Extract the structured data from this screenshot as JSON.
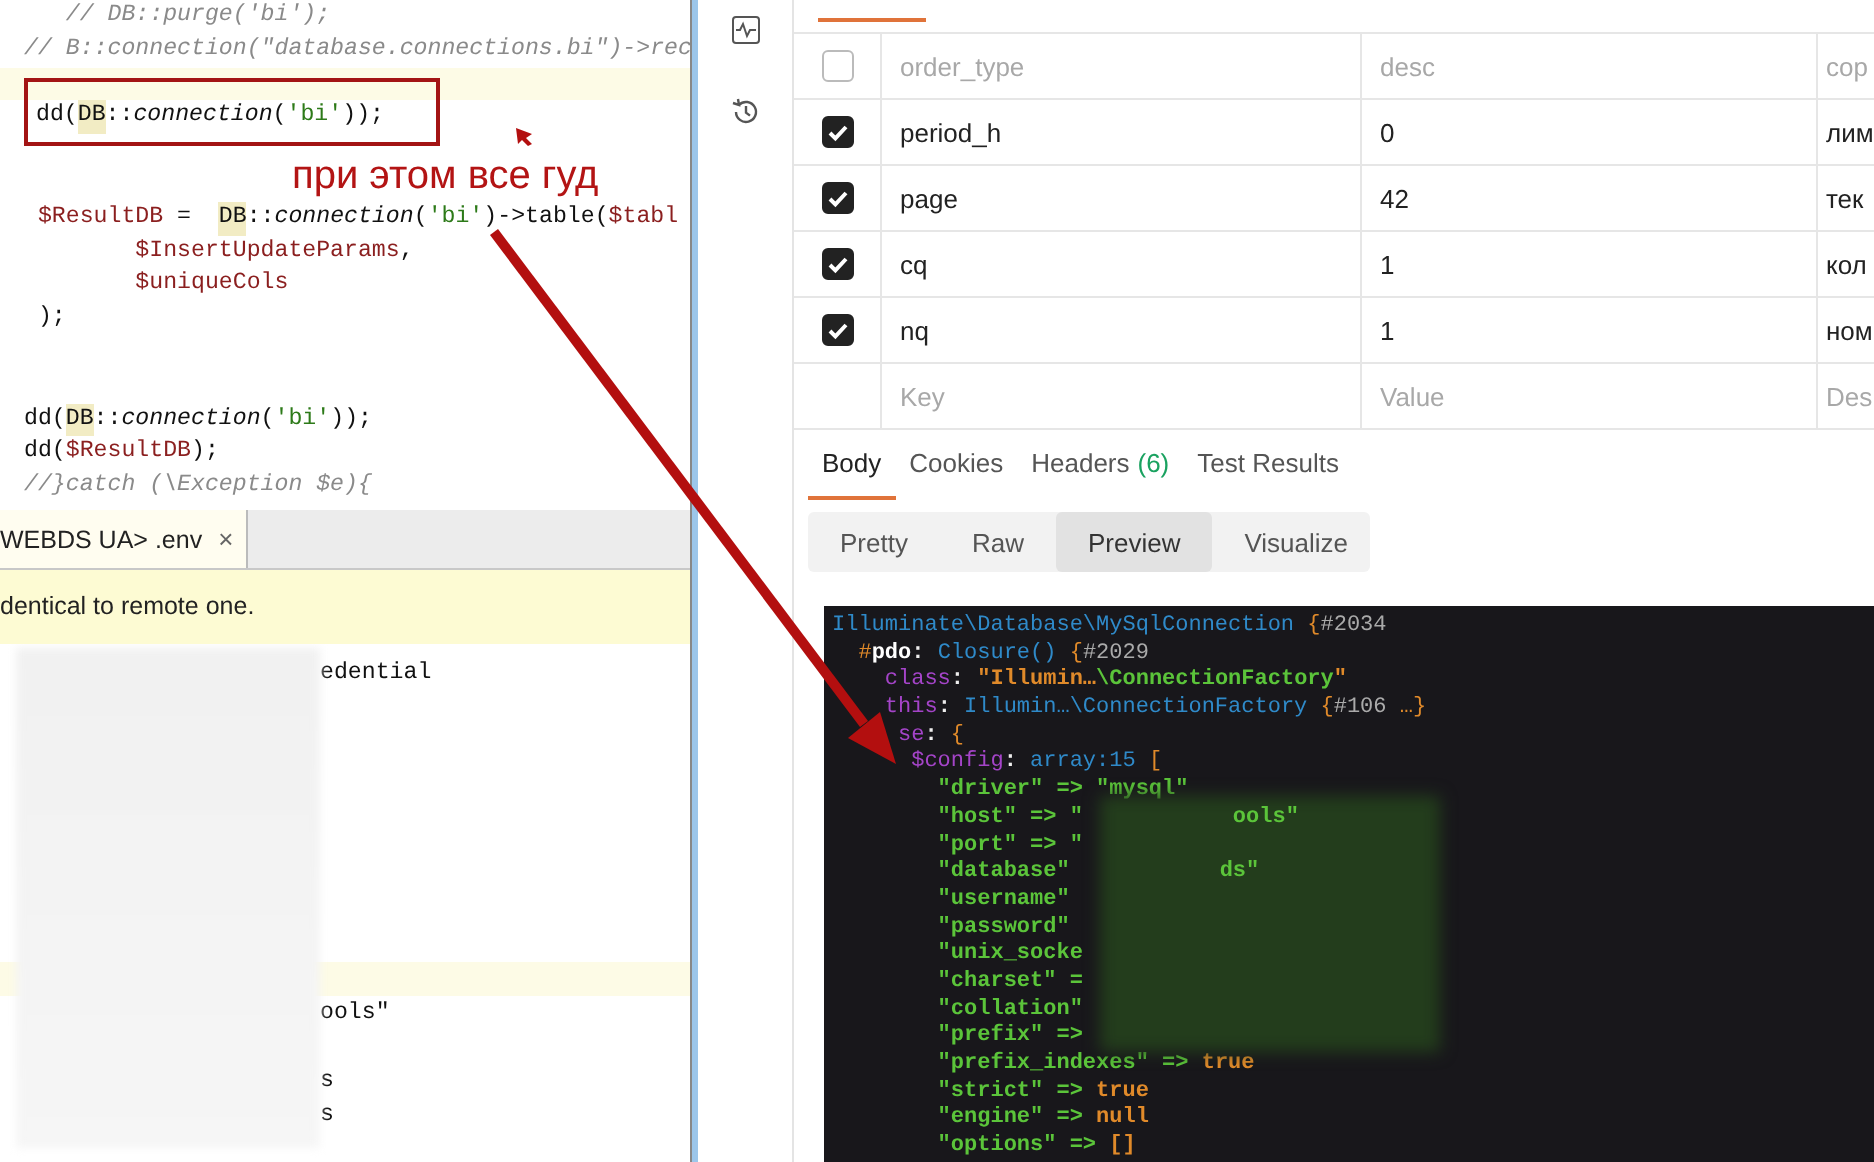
{
  "editor": {
    "lines": [
      {
        "kind": "code",
        "tokens": [
          {
            "kind": "comment",
            "text": "   // DB::purge('bi');"
          }
        ]
      },
      {
        "kind": "code",
        "tokens": [
          {
            "kind": "comment",
            "text": "// B::connection(\"database.connections.bi\")->rec"
          }
        ]
      },
      {
        "kind": "current"
      },
      {
        "kind": "code",
        "boxed": true,
        "tokens": [
          {
            "kind": "plain",
            "text": "dd("
          },
          {
            "kind": "cls",
            "text": "DB"
          },
          {
            "kind": "plain",
            "text": "::"
          },
          {
            "kind": "method",
            "text": "connection"
          },
          {
            "kind": "plain",
            "text": "("
          },
          {
            "kind": "str",
            "text": "'bi'"
          },
          {
            "kind": "plain",
            "text": "));"
          }
        ]
      },
      {
        "kind": "blank"
      },
      {
        "kind": "blank"
      },
      {
        "kind": "code",
        "tokens": [
          {
            "kind": "var",
            "text": " $ResultDB"
          },
          {
            "kind": "plain",
            "text": " =  "
          },
          {
            "kind": "cls",
            "text": "DB"
          },
          {
            "kind": "plain",
            "text": "::"
          },
          {
            "kind": "method",
            "text": "connection"
          },
          {
            "kind": "plain",
            "text": "("
          },
          {
            "kind": "str",
            "text": "'bi'"
          },
          {
            "kind": "plain",
            "text": ")"
          },
          {
            "kind": "plain",
            "text": "->table("
          },
          {
            "kind": "var",
            "text": "$tabl"
          }
        ]
      },
      {
        "kind": "code",
        "tokens": [
          {
            "kind": "var",
            "text": "        $InsertUpdateParams"
          },
          {
            "kind": "plain",
            "text": ","
          }
        ]
      },
      {
        "kind": "code",
        "tokens": [
          {
            "kind": "var",
            "text": "        $uniqueCols"
          }
        ]
      },
      {
        "kind": "code",
        "tokens": [
          {
            "kind": "plain",
            "text": " );"
          }
        ]
      },
      {
        "kind": "blank"
      },
      {
        "kind": "blank"
      },
      {
        "kind": "code",
        "tokens": [
          {
            "kind": "plain",
            "text": "dd("
          },
          {
            "kind": "cls",
            "text": "DB"
          },
          {
            "kind": "plain",
            "text": "::"
          },
          {
            "kind": "method",
            "text": "connection"
          },
          {
            "kind": "plain",
            "text": "("
          },
          {
            "kind": "str",
            "text": "'bi'"
          },
          {
            "kind": "plain",
            "text": "));"
          }
        ]
      },
      {
        "kind": "code",
        "tokens": [
          {
            "kind": "plain",
            "text": "dd("
          },
          {
            "kind": "var",
            "text": "$ResultDB"
          },
          {
            "kind": "plain",
            "text": ");"
          }
        ]
      },
      {
        "kind": "code",
        "tokens": [
          {
            "kind": "comment",
            "text": "//}catch (\\Exception $e){"
          }
        ]
      }
    ]
  },
  "annotation": {
    "text": "при этом все гуд"
  },
  "file_tab": {
    "label": "WEBDS UA> .env",
    "close": "×",
    "selected": true
  },
  "notice": {
    "text": "dentical to remote one."
  },
  "env_editor": {
    "lines": [
      {
        "kind": "code",
        "text": "edential"
      },
      {
        "kind": "blank"
      },
      {
        "kind": "blank"
      },
      {
        "kind": "blank"
      },
      {
        "kind": "blank"
      },
      {
        "kind": "blank"
      },
      {
        "kind": "blank"
      },
      {
        "kind": "blank"
      },
      {
        "kind": "blank"
      },
      {
        "kind": "current"
      },
      {
        "kind": "code",
        "text": "ools\""
      },
      {
        "kind": "blank"
      },
      {
        "kind": "code",
        "text": "s"
      },
      {
        "kind": "code",
        "text": "s"
      }
    ]
  },
  "params": {
    "rows": [
      {
        "checked": false,
        "key": "order_type",
        "value": "desc",
        "description": "cop"
      },
      {
        "checked": true,
        "key": "period_h",
        "value": "0",
        "description": "лим"
      },
      {
        "checked": true,
        "key": "page",
        "value": "42",
        "description": "тек"
      },
      {
        "checked": true,
        "key": "cq",
        "value": "1",
        "description": "кол"
      },
      {
        "checked": true,
        "key": "nq",
        "value": "1",
        "description": "ном"
      }
    ],
    "new_row": {
      "key_placeholder": "Key",
      "value_placeholder": "Value",
      "description_placeholder": "Des"
    }
  },
  "response_tabs": [
    {
      "label": "Body",
      "selected": true
    },
    {
      "label": "Cookies",
      "selected": false
    },
    {
      "label": "Headers",
      "count": "(6)",
      "selected": false
    },
    {
      "label": "Test Results",
      "selected": false
    }
  ],
  "format_buttons": [
    {
      "label": "Pretty",
      "selected": false
    },
    {
      "label": "Raw",
      "selected": false
    },
    {
      "label": "Preview",
      "selected": true
    },
    {
      "label": "Visualize",
      "selected": false
    }
  ],
  "dump": {
    "lines": [
      {
        "tokens": [
          {
            "kind": "cls",
            "text": "Illuminate\\Database\\MySqlConnection"
          },
          {
            "kind": "brace",
            "text": " {"
          },
          {
            "kind": "meta",
            "text": "#2034"
          }
        ]
      },
      {
        "tokens": [
          {
            "kind": "brace",
            "text": "  #"
          },
          {
            "kind": "prop",
            "text": "pdo"
          },
          {
            "kind": "plain",
            "text": ": "
          },
          {
            "kind": "cls",
            "text": "Closure()"
          },
          {
            "kind": "brace",
            "text": " {"
          },
          {
            "kind": "meta",
            "text": "#2029"
          }
        ]
      },
      {
        "tokens": [
          {
            "kind": "key",
            "text": "    class"
          },
          {
            "kind": "plain",
            "text": ": "
          },
          {
            "kind": "strh",
            "text": "\"Illumin…"
          },
          {
            "kind": "strb",
            "text": "\\ConnectionFactory"
          },
          {
            "kind": "strh",
            "text": "\""
          }
        ]
      },
      {
        "tokens": [
          {
            "kind": "key",
            "text": "    this"
          },
          {
            "kind": "plain",
            "text": ": "
          },
          {
            "kind": "cls",
            "text": "Illumin…\\ConnectionFactory"
          },
          {
            "kind": "brace",
            "text": " {"
          },
          {
            "kind": "meta",
            "text": "#106 "
          },
          {
            "kind": "brace",
            "text": "…}"
          }
        ]
      },
      {
        "tokens": [
          {
            "kind": "key",
            "text": "     se"
          },
          {
            "kind": "plain",
            "text": ": "
          },
          {
            "kind": "brace",
            "text": "{"
          }
        ]
      },
      {
        "tokens": [
          {
            "kind": "key",
            "text": "      $config"
          },
          {
            "kind": "plain",
            "text": ": "
          },
          {
            "kind": "cls",
            "text": "array:15"
          },
          {
            "kind": "brace",
            "text": " ["
          }
        ]
      },
      {
        "tokens": [
          {
            "kind": "str",
            "text": "        \"driver\" => \"mysql\""
          }
        ]
      },
      {
        "tokens": [
          {
            "kind": "str",
            "text": "        \"host\" => \""
          }
        ],
        "tail": "ools\""
      },
      {
        "tokens": [
          {
            "kind": "str",
            "text": "        \"port\" => \""
          }
        ]
      },
      {
        "tokens": [
          {
            "kind": "str",
            "text": "        \"database\""
          }
        ],
        "tail": "ds\""
      },
      {
        "tokens": [
          {
            "kind": "str",
            "text": "        \"username\""
          }
        ]
      },
      {
        "tokens": [
          {
            "kind": "str",
            "text": "        \"password\""
          }
        ]
      },
      {
        "tokens": [
          {
            "kind": "str",
            "text": "        \"unix_socke"
          }
        ]
      },
      {
        "tokens": [
          {
            "kind": "str",
            "text": "        \"charset\" ="
          }
        ]
      },
      {
        "tokens": [
          {
            "kind": "str",
            "text": "        \"collation\""
          }
        ]
      },
      {
        "tokens": [
          {
            "kind": "str",
            "text": "        \"prefix\" =>"
          }
        ]
      },
      {
        "tokens": [
          {
            "kind": "str",
            "text": "        \"prefix_indexes\" => "
          },
          {
            "kind": "kw",
            "text": "true"
          }
        ]
      },
      {
        "tokens": [
          {
            "kind": "str",
            "text": "        \"strict\" => "
          },
          {
            "kind": "kw",
            "text": "true"
          }
        ]
      },
      {
        "tokens": [
          {
            "kind": "str",
            "text": "        \"engine\" => "
          },
          {
            "kind": "kw",
            "text": "null"
          }
        ]
      },
      {
        "tokens": [
          {
            "kind": "str",
            "text": "        \"options\" => "
          },
          {
            "kind": "kw",
            "text": "[]"
          }
        ]
      }
    ]
  }
}
